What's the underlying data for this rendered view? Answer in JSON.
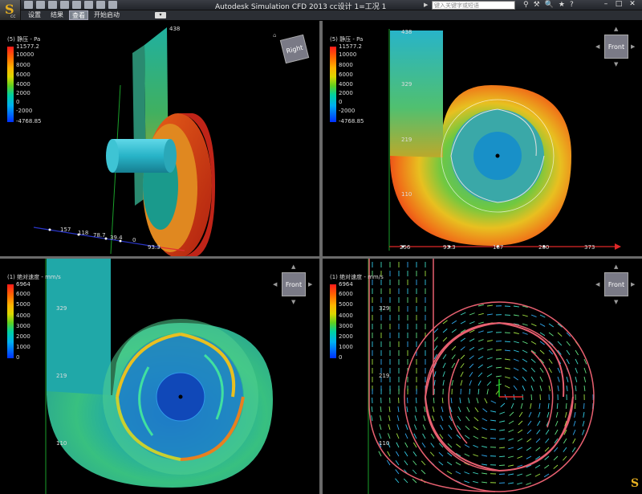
{
  "app": {
    "logo_letter": "S",
    "logo_sub": "cc",
    "title": "Autodesk Simulation CFD 2013   cc设计 1=工况 1",
    "search_placeholder": "键入关键字或短语"
  },
  "menu": {
    "items": [
      {
        "label": "设置",
        "active": false
      },
      {
        "label": "结果",
        "active": false
      },
      {
        "label": "查看",
        "active": true
      },
      {
        "label": "开始启动",
        "active": false
      }
    ]
  },
  "viewports": {
    "vp1": {
      "legend_title": "(5) 静压 - Pa",
      "ticks": [
        "11577.2",
        "10000",
        "8000",
        "6000",
        "4000",
        "2000",
        "0",
        "-2000",
        "-4768.85"
      ],
      "viewcube_label": "Right",
      "axis_labels": [
        "438",
        "157",
        "118",
        "78.7",
        "39.4",
        "0",
        "93.3"
      ]
    },
    "vp2": {
      "legend_title": "(5) 静压 - Pa",
      "ticks": [
        "11577.2",
        "10000",
        "8000",
        "6000",
        "4000",
        "2000",
        "0",
        "-2000",
        "-4768.85"
      ],
      "viewcube_label": "Front",
      "axis_labels": [
        "438",
        "329",
        "219",
        "110",
        "256",
        "93.3",
        "187",
        "280",
        "373"
      ]
    },
    "vp3": {
      "legend_title": "(1) 绝对速度 - mm/s",
      "ticks": [
        "6964",
        "6000",
        "5000",
        "4000",
        "3000",
        "2000",
        "1000",
        "0"
      ],
      "viewcube_label": "Front",
      "axis_labels": [
        "329",
        "219",
        "110"
      ]
    },
    "vp4": {
      "legend_title": "(1) 绝对速度 - mm/s",
      "ticks": [
        "6964",
        "6000",
        "5000",
        "4000",
        "3000",
        "2000",
        "1000",
        "0"
      ],
      "viewcube_label": "Front",
      "axis_labels": [
        "329",
        "219",
        "110"
      ]
    }
  },
  "icons": [
    "save-icon",
    "open-icon",
    "print-icon",
    "search-icon",
    "help-icon",
    "star-icon",
    "close-icon"
  ],
  "colors": {
    "accent_red": "#ff2020",
    "accent_green": "#20d020",
    "background": "#000000"
  }
}
